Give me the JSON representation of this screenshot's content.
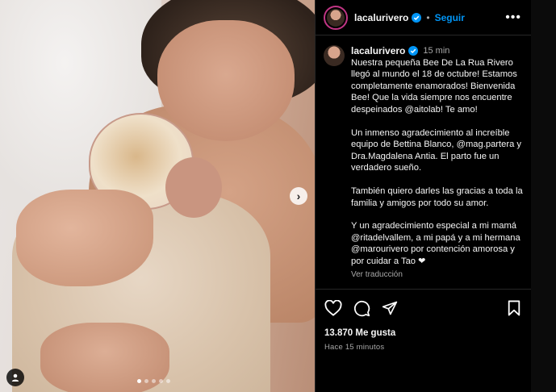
{
  "post": {
    "username": "lacalurivero",
    "follow_label": "Seguir",
    "separator": "•",
    "more_label": "•••",
    "time": "15 min",
    "caption": [
      "Nuestra pequeña Bee De La Rua Rivero llegó al mundo el 18 de octubre! Estamos completamente enamorados! Bienvenida Bee! Que la vida siempre nos encuentre despeinados @aitolab! Te amo!",
      "Un inmenso agradecimiento al increíble equipo de Bettina Blanco, @mag.partera y Dra.Magdalena Antia. El parto fue un verdadero sueño.",
      "También quiero darles las gracias a toda la familia y amigos por todo su amor.",
      "Y un agradecimiento especial a mi mamá @ritadelvallem, a mi papá y a mi hermana @marourivero por contención amorosa y por cuidar a Tao ❤"
    ],
    "translate_label": "Ver traducción",
    "likes": "13.870 Me gusta",
    "posted_ago": "Hace 15 minutos",
    "next_label": "›"
  },
  "carousel": {
    "slides": 5,
    "active": 0
  },
  "colors": {
    "accent": "#0095f6",
    "background": "#000000",
    "muted": "#a8a8a8"
  },
  "icons": [
    "verified-badge-icon",
    "more-options-icon",
    "heart-icon",
    "comment-icon",
    "share-icon",
    "bookmark-icon",
    "user-tag-icon",
    "chevron-right-icon"
  ]
}
